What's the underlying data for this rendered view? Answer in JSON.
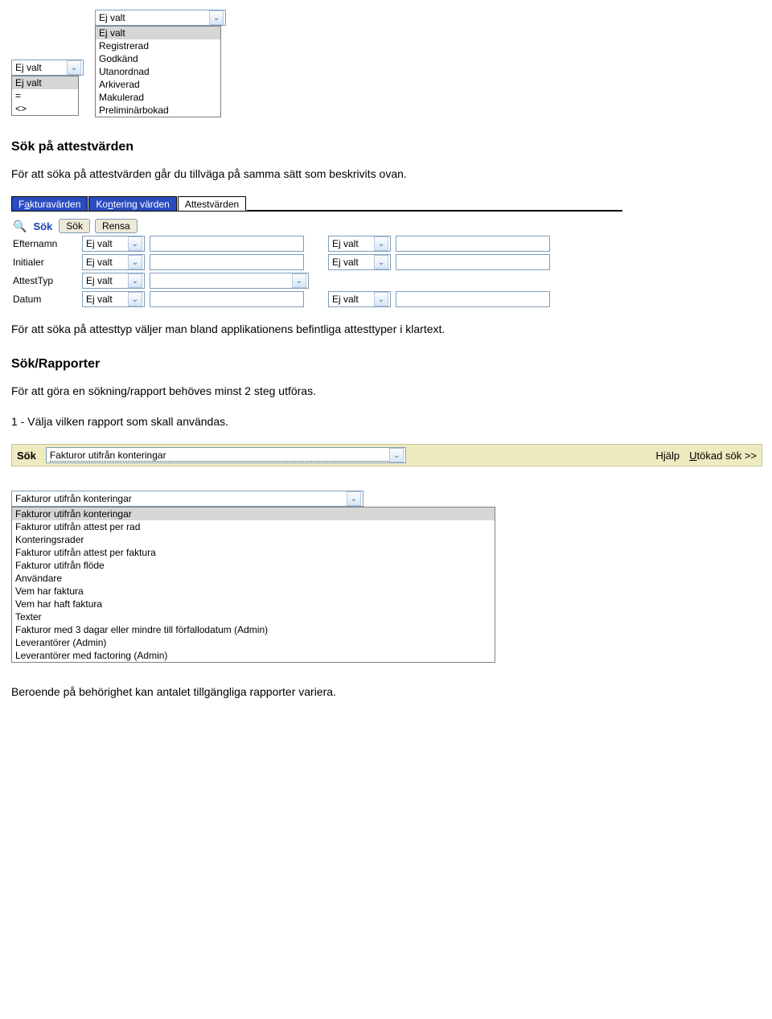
{
  "top": {
    "small_dd_value": "Ej valt",
    "small_options": [
      "Ej valt",
      "=",
      "<>"
    ],
    "wide_dd_value": "Ej valt",
    "wide_options": [
      "Ej valt",
      "Registrerad",
      "Godkänd",
      "Utanordnad",
      "Arkiverad",
      "Makulerad",
      "Preliminärbokad"
    ]
  },
  "section1_title": "Sök på attestvärden",
  "section1_text": "För att söka på attestvärden går du tillväga på samma sätt som beskrivits ovan.",
  "tabs": {
    "t1_pre": "F",
    "t1_u": "a",
    "t1_post": "kturavärden",
    "t2_pre": "Ko",
    "t2_u": "n",
    "t2_post": "tering värden",
    "t3": "Attestvärden"
  },
  "sp": {
    "sok": "Sök",
    "btn_sok": "Sök",
    "btn_rensa": "Rensa",
    "r1": "Efternamn",
    "r2": "Initialer",
    "r3": "AttestTyp",
    "r4": "Datum",
    "ejv": "Ej valt"
  },
  "after_panel_text": "För att söka på attesttyp väljer man bland applikationens befintliga attesttyper i klartext.",
  "section2_title": "Sök/Rapporter",
  "section2_p1": "För att göra en sökning/rapport behöves minst 2 steg utföras.",
  "section2_p2": "1 - Välja vilken rapport som skall användas.",
  "yellow": {
    "sok": "Sök",
    "selected": "Fakturor utifrån konteringar",
    "hjalp": "Hjälp",
    "utokad_pre": "U",
    "utokad_u": "t",
    "utokad_post": "ökad sök >>"
  },
  "reportdd": {
    "selected": "Fakturor utifrån konteringar",
    "items": [
      "Fakturor utifrån konteringar",
      "Fakturor utifrån attest per rad",
      "Konteringsrader",
      "Fakturor utifrån attest per faktura",
      "Fakturor utifrån flöde",
      "Användare",
      "Vem har faktura",
      "Vem har haft faktura",
      "Texter",
      "Fakturor med 3 dagar eller mindre till förfallodatum (Admin)",
      "Leverantörer (Admin)",
      "Leverantörer med factoring (Admin)"
    ]
  },
  "bottom_text": "Beroende på behörighet kan antalet tillgängliga rapporter variera."
}
